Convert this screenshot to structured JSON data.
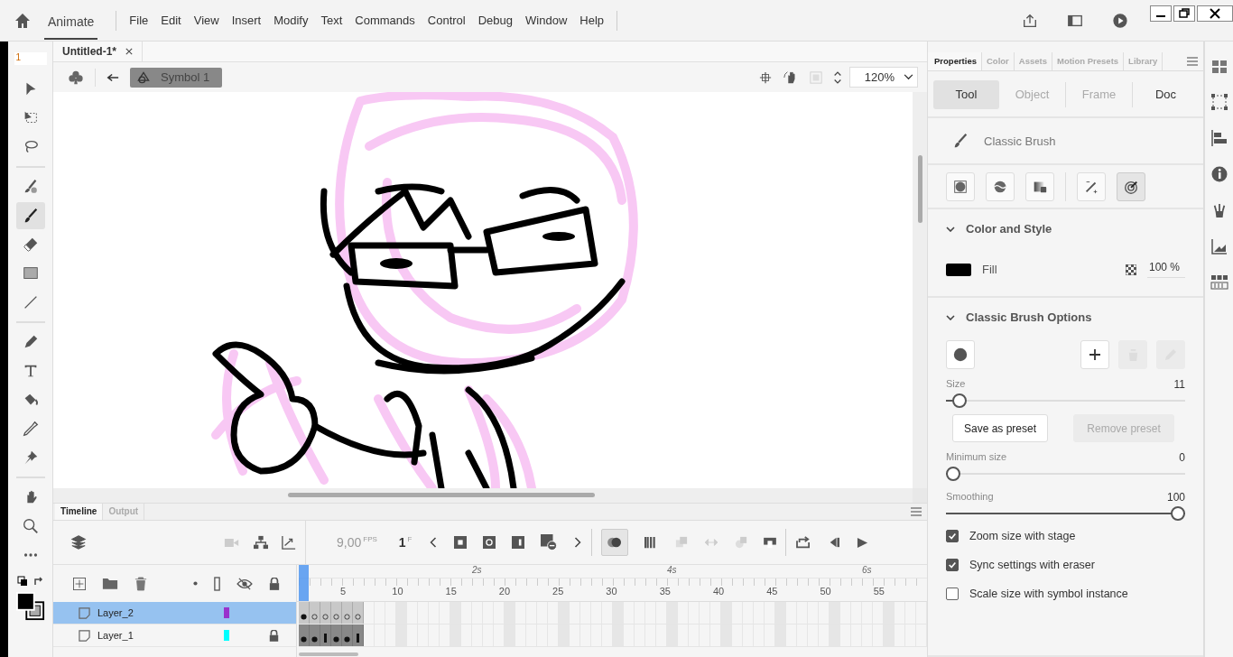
{
  "app": {
    "name": "Animate",
    "menu": [
      "File",
      "Edit",
      "View",
      "Insert",
      "Modify",
      "Text",
      "Commands",
      "Control",
      "Debug",
      "Window",
      "Help"
    ]
  },
  "toolbar": {
    "field": "1",
    "tools": [
      {
        "selected": false
      },
      {
        "selected": false
      },
      {
        "selected": false
      },
      {
        "selected": false
      },
      {
        "selected": true
      },
      {
        "selected": false
      },
      {
        "selected": false
      },
      {
        "selected": false
      },
      {
        "selected": false
      },
      {
        "selected": false
      },
      {
        "selected": false
      },
      {
        "selected": false
      },
      {
        "selected": false
      },
      {
        "selected": false
      },
      {
        "selected": false
      },
      {
        "selected": false
      }
    ]
  },
  "document_tab": {
    "title": "Untitled-1*"
  },
  "edit_bar": {
    "symbol": "Symbol 1",
    "zoom": "120%"
  },
  "timeline": {
    "tabs": [
      {
        "label": "Timeline",
        "selected": true
      },
      {
        "label": "Output",
        "selected": false
      }
    ],
    "fps": "9,00",
    "fps_unit": "FPS",
    "frame": "1",
    "frame_unit": "F",
    "seconds": [
      "2s",
      "4s",
      "6s"
    ],
    "frame_numbers": [
      "5",
      "10",
      "15",
      "20",
      "25",
      "30",
      "35",
      "40",
      "45",
      "50",
      "55"
    ],
    "layers": [
      {
        "name": "Layer_2",
        "selected": true,
        "color": "#9933cc",
        "locked": false,
        "frames": [
          {
            "kind": "keyframe"
          },
          {
            "kind": "blank"
          },
          {
            "kind": "blank"
          },
          {
            "kind": "blank"
          },
          {
            "kind": "blank"
          },
          {
            "kind": "blank"
          }
        ]
      },
      {
        "name": "Layer_1",
        "selected": false,
        "color": "#00ffff",
        "locked": true,
        "frames": [
          {
            "kind": "keyframe"
          },
          {
            "kind": "keyframe"
          },
          {
            "kind": "end"
          },
          {
            "kind": "keyframe"
          },
          {
            "kind": "keyframe"
          },
          {
            "kind": "end"
          }
        ]
      }
    ]
  },
  "properties": {
    "tabs": [
      {
        "label": "Properties",
        "selected": true
      },
      {
        "label": "Color",
        "selected": false
      },
      {
        "label": "Assets",
        "selected": false
      },
      {
        "label": "Motion Presets",
        "selected": false
      },
      {
        "label": "Library",
        "selected": false
      }
    ],
    "subtabs": [
      {
        "label": "Tool",
        "selected": true,
        "disabled": false
      },
      {
        "label": "Object",
        "selected": false,
        "disabled": true
      },
      {
        "label": "Frame",
        "selected": false,
        "disabled": true
      },
      {
        "label": "Doc",
        "selected": false,
        "disabled": false
      }
    ],
    "tool_name": "Classic Brush",
    "modes": [
      {
        "selected": false
      },
      {
        "selected": false
      },
      {
        "selected": false
      },
      {
        "selected": false
      },
      {
        "selected": true
      }
    ],
    "color_style": {
      "title": "Color and Style",
      "expanded": true,
      "fill_label": "Fill",
      "opacity": "100 %"
    },
    "brush_options": {
      "title": "Classic Brush Options",
      "expanded": true,
      "preset_actions": [
        {
          "disabled": false
        },
        {
          "disabled": true
        },
        {
          "disabled": true
        }
      ],
      "sliders": [
        {
          "label": "Size",
          "value": "11",
          "level": 0.03
        },
        {
          "label": "Minimum size",
          "value": "0",
          "level": 0
        },
        {
          "label": "Smoothing",
          "value": "100",
          "level": 1
        }
      ],
      "save_preset": {
        "label": "Save as preset",
        "disabled": false
      },
      "remove_preset": {
        "label": "Remove preset",
        "disabled": true
      },
      "checkboxes": [
        {
          "label": "Zoom size with stage",
          "checked": true
        },
        {
          "label": "Sync settings with eraser",
          "checked": true
        },
        {
          "label": "Scale size with symbol instance",
          "checked": false
        }
      ]
    }
  }
}
